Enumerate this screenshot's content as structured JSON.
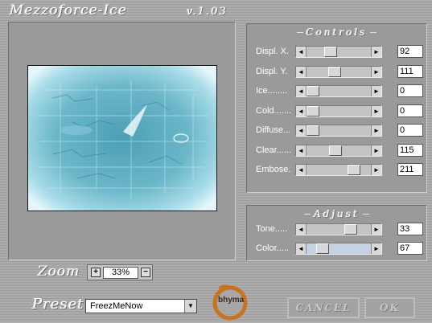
{
  "window": {
    "title": "Mezzoforce-Ice",
    "version": "v.1.03"
  },
  "controls": {
    "heading": "Controls",
    "sliders": [
      {
        "label": "Displ. X.",
        "value": "92",
        "level": 0.36
      },
      {
        "label": "Displ. Y.",
        "value": "111",
        "level": 0.44
      },
      {
        "label": "Ice........",
        "value": "0",
        "level": 0.0
      },
      {
        "label": "Cold.......",
        "value": "0",
        "level": 0.0
      },
      {
        "label": "Diffuse...",
        "value": "0",
        "level": 0.0
      },
      {
        "label": "Clear......",
        "value": "115",
        "level": 0.45
      },
      {
        "label": "Embose.",
        "value": "211",
        "level": 0.83
      }
    ]
  },
  "adjust": {
    "heading": "Adjust",
    "sliders": [
      {
        "label": "Tone.....",
        "value": "33",
        "level": 0.76
      },
      {
        "label": "Color.....",
        "value": "67",
        "level": 0.2
      }
    ]
  },
  "zoom": {
    "label": "Zoom",
    "value": "33%",
    "plus": "+",
    "minus": "−"
  },
  "preset": {
    "label": "Preset",
    "value": "FreezMeNow"
  },
  "logo": {
    "text": "bhyma"
  },
  "buttons": {
    "cancel": "CANCEL",
    "ok": "OK"
  },
  "icons": {
    "left_arrow": "◄",
    "right_arrow": "►",
    "dropdown": "▼"
  }
}
